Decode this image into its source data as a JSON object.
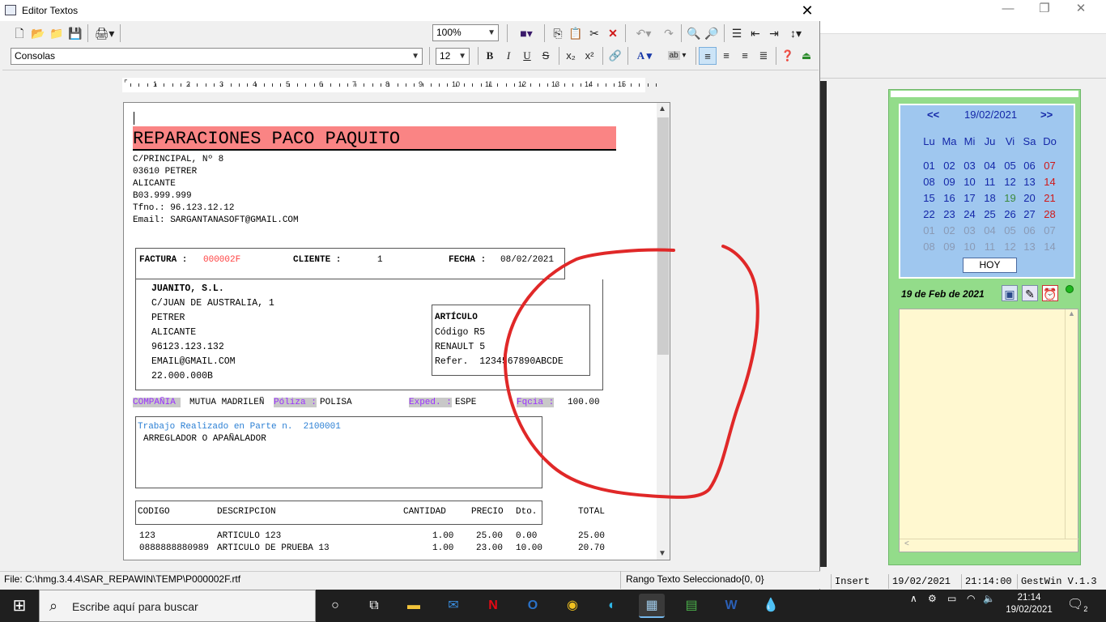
{
  "window": {
    "title": "Editor Textos",
    "close": "✕"
  },
  "toolbar": {
    "zoom": "100%",
    "font": "Consolas",
    "size": "12"
  },
  "ruler": "1 · 2 · 3 · 4 · 5 · 6 · 7 · 8 · 9 · 10 · 11 · 12 · 13 · 14 · 15",
  "doc": {
    "company": "REPARACIONES PACO PAQUITO",
    "address": [
      "C/PRINCIPAL, Nº 8",
      "03610 PETRER",
      "ALICANTE",
      "B03.999.999",
      "Tfno.: 96.123.12.12",
      "Email: SARGANTANASOFT@GMAIL.COM"
    ],
    "factura_label": "FACTURA :",
    "factura_num": "000002F",
    "cliente_label": "CLIENTE :",
    "cliente_num": "1",
    "fecha_label": "FECHA :",
    "fecha": "08/02/2021",
    "customer": [
      "JUANITO, S.L.",
      "C/JUAN DE AUSTRALIA, 1",
      "PETRER",
      "ALICANTE",
      "96123.123.132",
      "EMAIL@GMAIL.COM",
      "22.000.000B"
    ],
    "articulo_title": "ARTÍCULO",
    "articulo": [
      "Código R5",
      "RENAULT 5",
      "Refer.  1234567890ABCDE"
    ],
    "compania_label": "COMPAÑIA ",
    "compania": "MUTUA MADRILEÑ",
    "poliza_label": "Póliza :",
    "poliza": "POLISA",
    "exped_label": "Exped. :",
    "exped": "ESPE",
    "fqcia_label": "Fqcia :",
    "fqcia": "100.00",
    "trabajo": "Trabajo Realizado en Parte n.  2100001",
    "trabajo_desc": "ARREGLADOR O APAÑALADOR",
    "headers": [
      "CODIGO",
      "DESCRIPCION",
      "CANTIDAD",
      "PRECIO",
      "Dto.",
      "TOTAL"
    ],
    "rows": [
      [
        "123",
        "ARTICULO 123",
        "1.00",
        "25.00",
        "0.00",
        "25.00"
      ],
      [
        "0888888880989",
        "ARTICULO DE PRUEBA 13",
        "1.00",
        "23.00",
        "10.00",
        "20.70"
      ]
    ]
  },
  "status": {
    "file": "File: C:\\hmg.3.4.4\\SAR_REPAWIN\\TEMP\\P000002F.rtf",
    "range": "Rango Texto Seleccionado{0, 0}"
  },
  "bg_status": {
    "insert": "Insert",
    "date": "19/02/2021",
    "time": "21:14:00",
    "app": "GestWin V.1.3"
  },
  "calendar": {
    "prev": "<<",
    "current": "19/02/2021",
    "next": ">>",
    "days": [
      "Lu",
      "Ma",
      "Mi",
      "Ju",
      "Vi",
      "Sa",
      "Do"
    ],
    "weeks": [
      [
        "01",
        "02",
        "03",
        "04",
        "05",
        "06",
        "07"
      ],
      [
        "08",
        "09",
        "10",
        "11",
        "12",
        "13",
        "14"
      ],
      [
        "15",
        "16",
        "17",
        "18",
        "19",
        "20",
        "21"
      ],
      [
        "22",
        "23",
        "24",
        "25",
        "26",
        "27",
        "28"
      ],
      [
        "01",
        "02",
        "03",
        "04",
        "05",
        "06",
        "07"
      ],
      [
        "08",
        "09",
        "10",
        "11",
        "12",
        "13",
        "14"
      ]
    ],
    "today_btn": "HOY",
    "long_date": "19 de Feb de 2021"
  },
  "taskbar": {
    "search": "Escribe aquí para buscar",
    "time": "21:14",
    "date": "19/02/2021",
    "notif": "2"
  },
  "colors": {
    "company_bg": "#fa8484",
    "annotation": "#e02020",
    "calendar_bg": "#93dc8a"
  }
}
